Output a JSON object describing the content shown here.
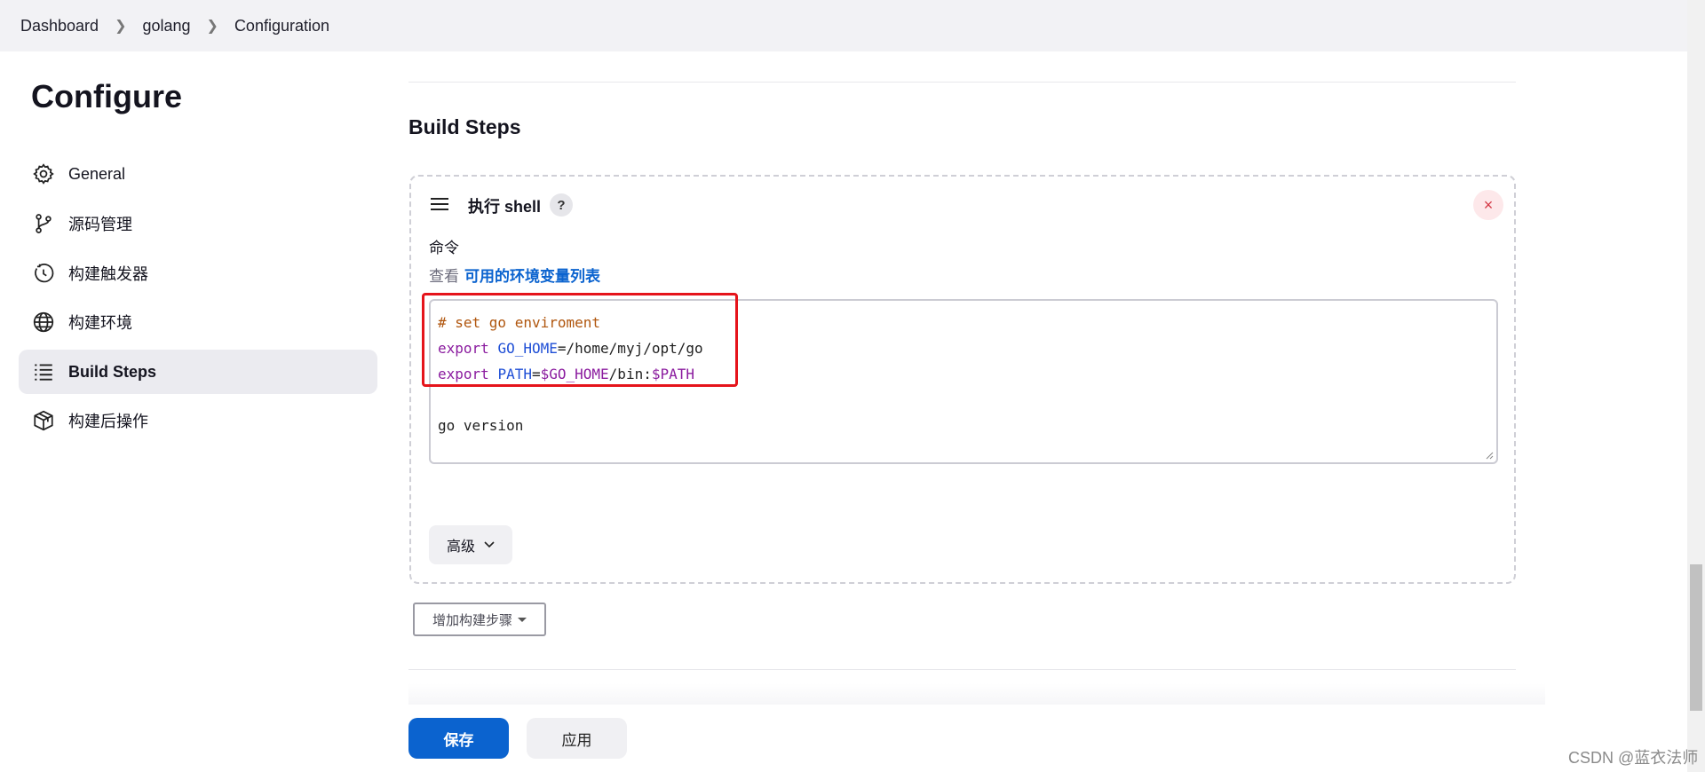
{
  "breadcrumb": {
    "items": [
      "Dashboard",
      "golang",
      "Configuration"
    ],
    "separator": ">"
  },
  "sidebar": {
    "title": "Configure",
    "items": [
      {
        "label": "General",
        "icon": "gear-icon"
      },
      {
        "label": "源码管理",
        "icon": "branch-icon"
      },
      {
        "label": "构建触发器",
        "icon": "clock-icon"
      },
      {
        "label": "构建环境",
        "icon": "globe-icon"
      },
      {
        "label": "Build Steps",
        "icon": "list-icon",
        "active": true
      },
      {
        "label": "构建后操作",
        "icon": "package-icon"
      }
    ]
  },
  "main": {
    "section_title": "Build Steps",
    "step": {
      "title": "执行 shell",
      "help": "?",
      "close": "×",
      "field_label": "命令",
      "env_prefix": "查看",
      "env_link": "可用的环境变量列表",
      "code": {
        "line1": "# set go enviroment",
        "line2_kw": "export",
        "line2_var": "GO_HOME",
        "line2_rest": "=/home/myj/opt/go",
        "line3_kw": "export",
        "line3_var": "PATH",
        "line3_eq": "=",
        "line3_ref1": "$GO_HOME",
        "line3_mid": "/bin:",
        "line3_ref2": "$PATH",
        "line5": "go version"
      },
      "advanced_label": "高级"
    },
    "add_step_label": "增加构建步骤"
  },
  "footer": {
    "save_label": "保存",
    "apply_label": "应用"
  },
  "watermark": "CSDN @蓝衣法师",
  "colors": {
    "accent": "#0b63cf",
    "highlight": "#e5141b",
    "close": "#d43a47"
  }
}
